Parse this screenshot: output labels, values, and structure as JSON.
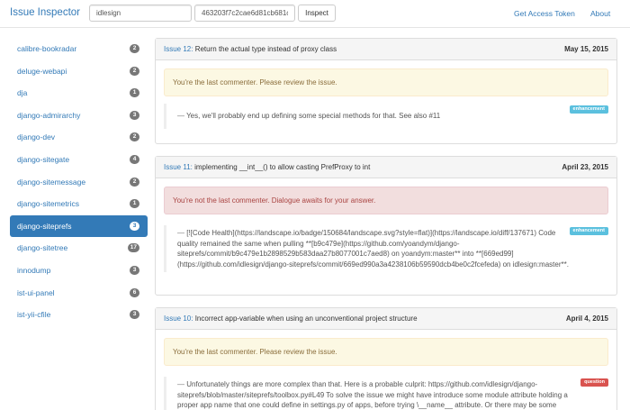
{
  "navbar": {
    "brand": "Issue Inspector",
    "user_input_value": "idlesign",
    "token_input_value": "463203f7c2cae6d81cb681c",
    "inspect_button": "Inspect",
    "get_token_link": "Get Access Token",
    "about_link": "About"
  },
  "sidebar": {
    "items": [
      {
        "label": "calibre-bookradar",
        "count": "2"
      },
      {
        "label": "deluge-webapi",
        "count": "2"
      },
      {
        "label": "dja",
        "count": "1"
      },
      {
        "label": "django-admirarchy",
        "count": "3"
      },
      {
        "label": "django-dev",
        "count": "2"
      },
      {
        "label": "django-sitegate",
        "count": "4"
      },
      {
        "label": "django-sitemessage",
        "count": "2"
      },
      {
        "label": "django-sitemetrics",
        "count": "1"
      },
      {
        "label": "django-siteprefs",
        "count": "3"
      },
      {
        "label": "django-sitetree",
        "count": "17"
      },
      {
        "label": "innodump",
        "count": "3"
      },
      {
        "label": "ist-ui-panel",
        "count": "6"
      },
      {
        "label": "ist-yii-cfile",
        "count": "3"
      }
    ]
  },
  "issues": [
    {
      "number": "Issue 12:",
      "title": "Return the actual type instead of proxy class",
      "date": "May 15, 2015",
      "alert": "You're the last commenter. Please review the issue.",
      "comment": "Yes, we'll probably end up defining some special methods for that. See also #11",
      "label": "enhancement"
    },
    {
      "number": "Issue 11:",
      "title": "implementing __int__() to allow casting PrefProxy to int",
      "date": "April 23, 2015",
      "alert": "You're not the last commenter. Dialogue awaits for your answer.",
      "comment": "[![Code Health](https://landscape.io/badge/150684/landscape.svg?style=flat)](https://landscape.io/diff/137671) Code quality remained the same when pulling **[b9c479e](https://github.com/yoandym/django-siteprefs/commit/b9c479e1b2898529b583daa27b8077001c7aed8) on yoandym:master** into **[669ed99](https://github.com/idlesign/django-siteprefs/commit/669ed990a3a4238106b59590dcb4be0c2fcefeda) on idlesign:master**.",
      "label": "enhancement"
    },
    {
      "number": "Issue 10:",
      "title": "Incorrect app-variable when using an unconventional project structure",
      "date": "April 4, 2015",
      "alert": "You're the last commenter. Please review the issue.",
      "comment": "Unfortunately things are more complex than that. Here is a probable culprit: https://github.com/idlesign/django-siteprefs/blob/master/siteprefs/toolbox.py#L49 To solve the issue we might have introduce some module attribute holding a proper app name that one could define in settings.py of apps, before trying \\__name__ attribute. Or there may be some other",
      "label": "question"
    }
  ],
  "dash": "—",
  "colors": {
    "brand": "#337ab7",
    "active_item": "#337ab7",
    "badge": "#777777",
    "warning_bg": "#fcf8e3",
    "danger_bg": "#f2dede",
    "label_enhancement": "#5bc0de",
    "label_question": "#d9534f"
  }
}
